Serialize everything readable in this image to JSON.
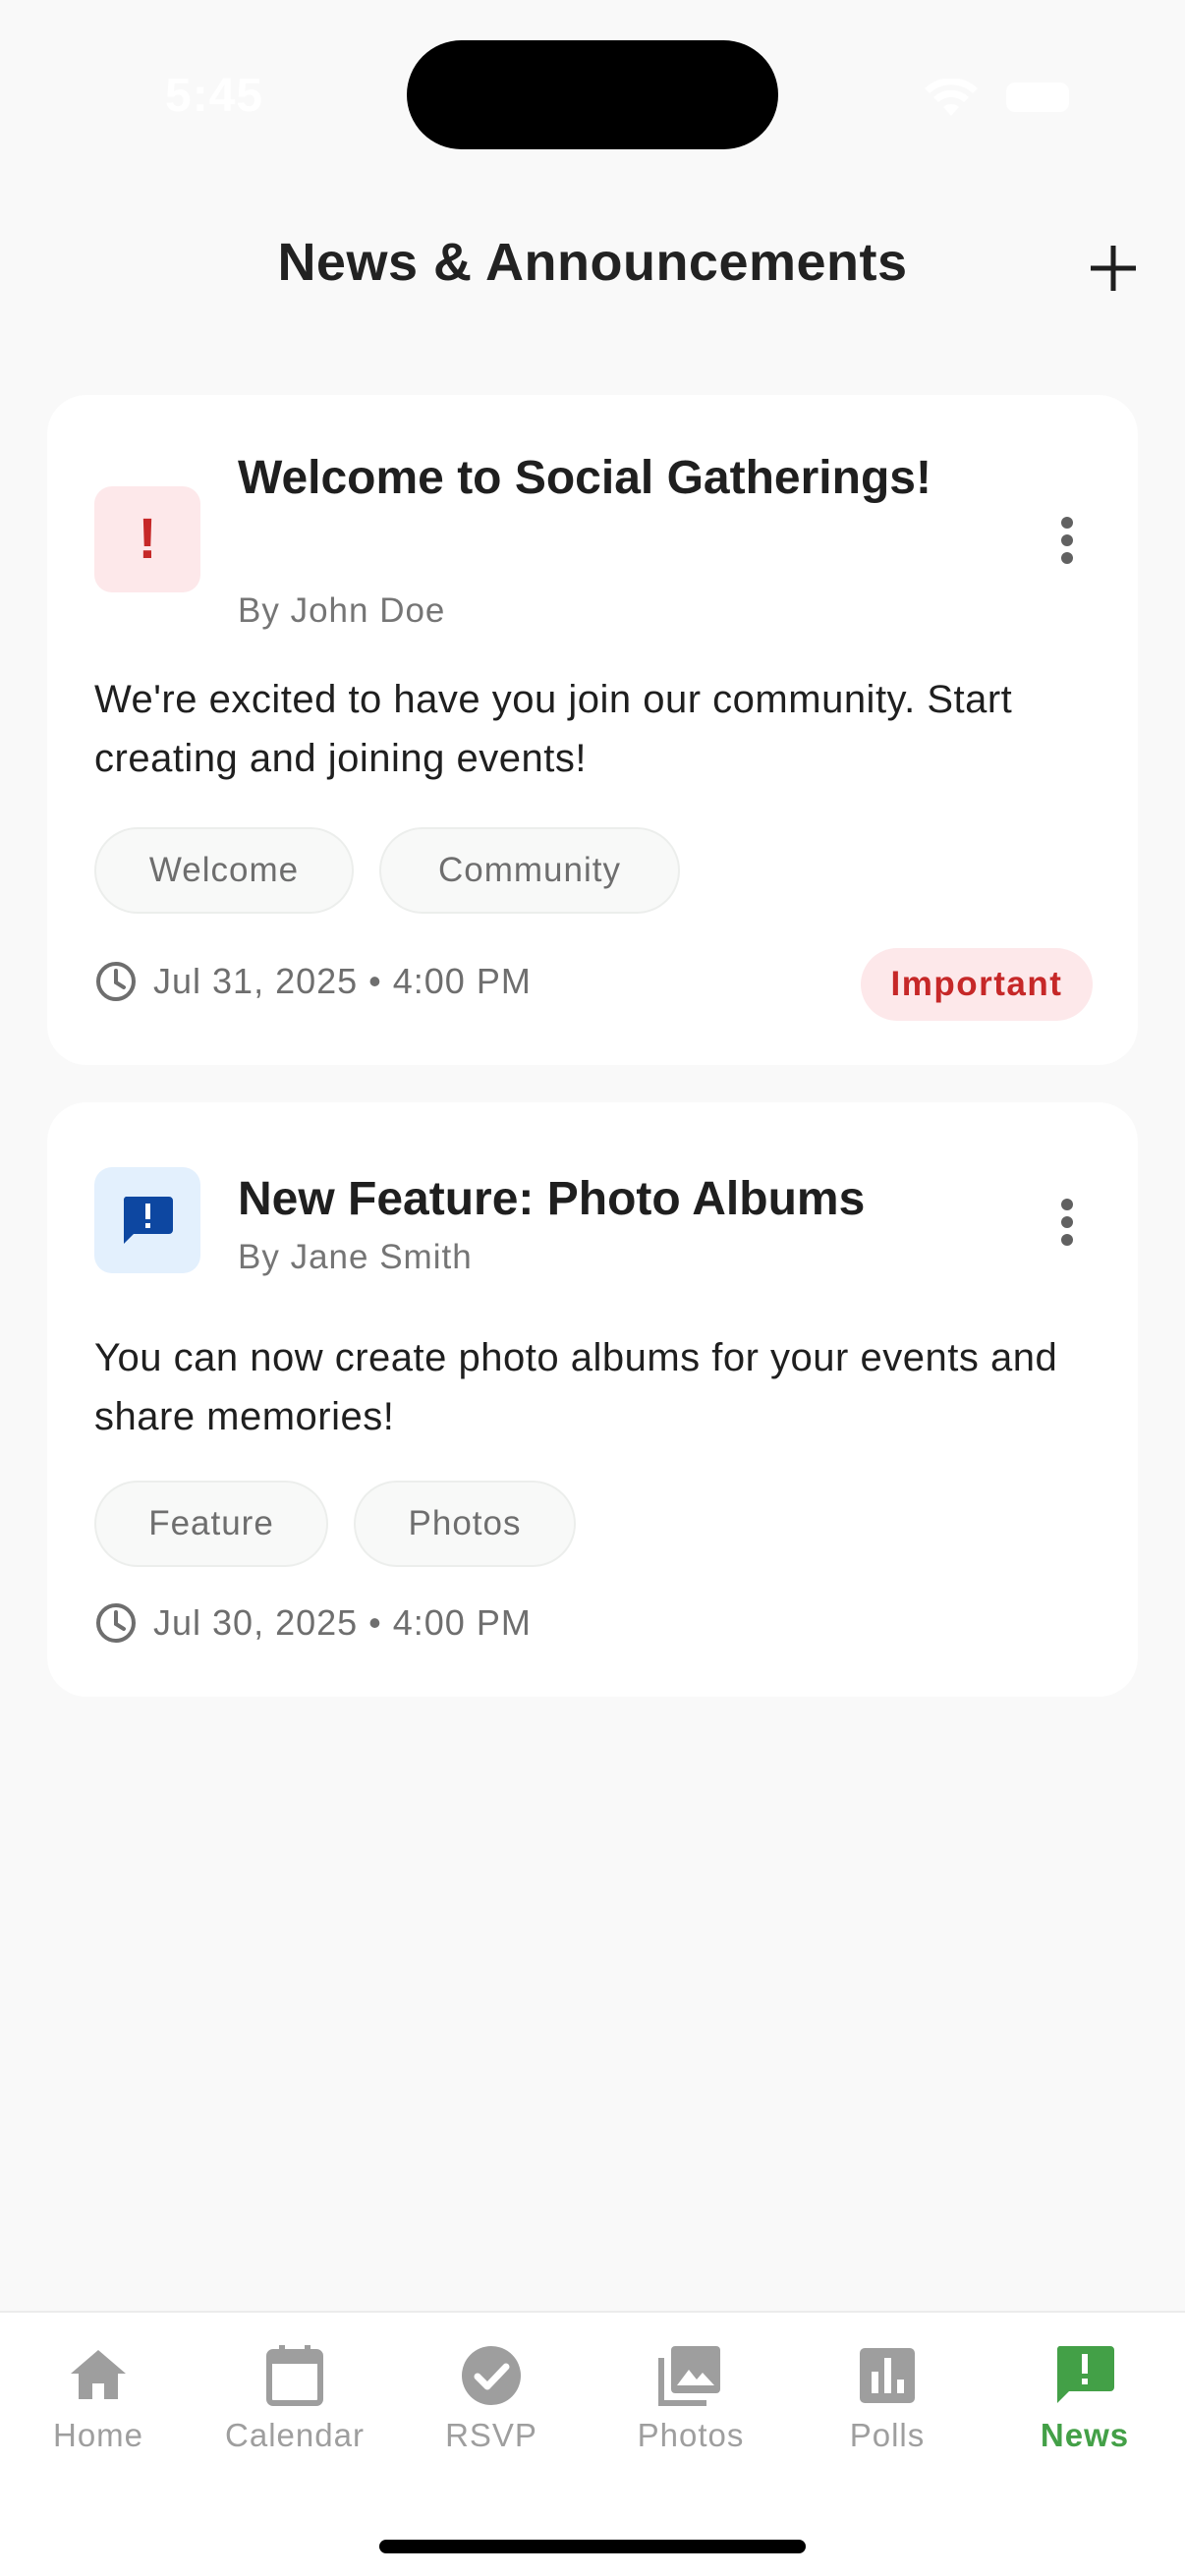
{
  "status_bar": {
    "time": "5:45"
  },
  "header": {
    "title": "News & Announcements",
    "add_icon": "plus-icon"
  },
  "announcements": [
    {
      "icon": "priority-high-icon",
      "title": "Welcome to Social Gatherings!",
      "author": "By John Doe",
      "body": "We're excited to have you join our community. Start creating and joining events!",
      "tags": [
        "Welcome",
        "Community"
      ],
      "timestamp": "Jul 31, 2025 • 4:00 PM",
      "badge": "Important"
    },
    {
      "icon": "feedback-icon",
      "title": "New Feature: Photo Albums",
      "author": "By Jane Smith",
      "body": "You can now create photo albums for your events and share memories!",
      "tags": [
        "Feature",
        "Photos"
      ],
      "timestamp": "Jul 30, 2025 • 4:00 PM"
    }
  ],
  "bottom_nav": {
    "items": [
      {
        "label": "Home",
        "icon": "home-icon"
      },
      {
        "label": "Calendar",
        "icon": "calendar-icon"
      },
      {
        "label": "RSVP",
        "icon": "check-circle-icon"
      },
      {
        "label": "Photos",
        "icon": "photo-library-icon"
      },
      {
        "label": "Polls",
        "icon": "poll-icon"
      },
      {
        "label": "News",
        "icon": "announcement-icon"
      }
    ],
    "active": "News"
  },
  "colors": {
    "accent": "#43a047",
    "important": "#c62828",
    "important_bg": "#fde8ea",
    "info_blue": "#0d47a1",
    "info_bg": "#e3f0fd",
    "background": "#f9f9f9"
  }
}
